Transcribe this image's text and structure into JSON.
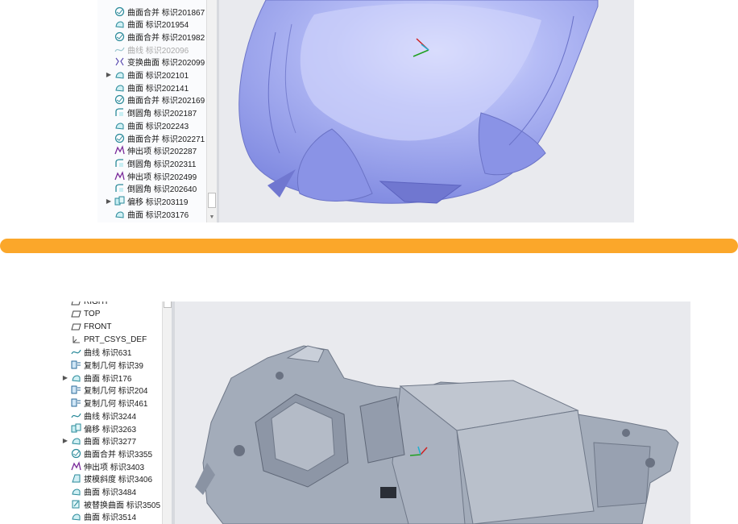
{
  "top_panel": {
    "tree_items": [
      {
        "label": "曲面合并 标识201867",
        "icon": "merge-icon",
        "expand": false,
        "dim": false
      },
      {
        "label": "曲面 标识201954",
        "icon": "surface-icon",
        "expand": false,
        "dim": false
      },
      {
        "label": "曲面合并 标识201982",
        "icon": "merge-icon",
        "expand": false,
        "dim": false
      },
      {
        "label": "曲线 标识202096",
        "icon": "curve-icon",
        "expand": false,
        "dim": true
      },
      {
        "label": "变换曲面 标识202099",
        "icon": "transform-surface-icon",
        "expand": false,
        "dim": false
      },
      {
        "label": "曲面 标识202101",
        "icon": "surface-icon",
        "expand": true,
        "dim": false
      },
      {
        "label": "曲面 标识202141",
        "icon": "surface-icon",
        "expand": false,
        "dim": false
      },
      {
        "label": "曲面合并 标识202169",
        "icon": "merge-icon",
        "expand": false,
        "dim": false
      },
      {
        "label": "倒圆角 标识202187",
        "icon": "round-icon",
        "expand": false,
        "dim": false
      },
      {
        "label": "曲面 标识202243",
        "icon": "surface-icon",
        "expand": false,
        "dim": false
      },
      {
        "label": "曲面合并 标识202271",
        "icon": "merge-icon",
        "expand": false,
        "dim": false
      },
      {
        "label": "伸出项 标识202287",
        "icon": "protrusion-icon",
        "expand": false,
        "dim": false
      },
      {
        "label": "倒圆角 标识202311",
        "icon": "round-icon",
        "expand": false,
        "dim": false
      },
      {
        "label": "伸出项 标识202499",
        "icon": "protrusion-icon",
        "expand": false,
        "dim": false
      },
      {
        "label": "倒圆角 标识202640",
        "icon": "round-icon",
        "expand": false,
        "dim": false
      },
      {
        "label": "偏移 标识203119",
        "icon": "offset-icon",
        "expand": true,
        "dim": false
      },
      {
        "label": "曲面 标识203176",
        "icon": "surface-icon",
        "expand": false,
        "dim": false
      }
    ]
  },
  "bottom_panel": {
    "tree_items": [
      {
        "label": "RIGHT",
        "icon": "datum-plane-icon",
        "expand": false,
        "dim": false
      },
      {
        "label": "TOP",
        "icon": "datum-plane-icon",
        "expand": false,
        "dim": false
      },
      {
        "label": "FRONT",
        "icon": "datum-plane-icon",
        "expand": false,
        "dim": false
      },
      {
        "label": "PRT_CSYS_DEF",
        "icon": "csys-icon",
        "expand": false,
        "dim": false
      },
      {
        "label": "曲线 标识631",
        "icon": "curve-icon",
        "expand": false,
        "dim": false
      },
      {
        "label": "复制几何 标识39",
        "icon": "copy-geometry-icon",
        "expand": false,
        "dim": false
      },
      {
        "label": "曲面 标识176",
        "icon": "surface-icon",
        "expand": true,
        "dim": false
      },
      {
        "label": "复制几何 标识204",
        "icon": "copy-geometry-icon",
        "expand": false,
        "dim": false
      },
      {
        "label": "复制几何 标识461",
        "icon": "copy-geometry-icon",
        "expand": false,
        "dim": false
      },
      {
        "label": "曲线 标识3244",
        "icon": "curve-icon",
        "expand": false,
        "dim": false
      },
      {
        "label": "偏移 标识3263",
        "icon": "offset-icon",
        "expand": false,
        "dim": false
      },
      {
        "label": "曲面 标识3277",
        "icon": "surface-icon",
        "expand": true,
        "dim": false
      },
      {
        "label": "曲面合并 标识3355",
        "icon": "merge-icon",
        "expand": false,
        "dim": false
      },
      {
        "label": "伸出项 标识3403",
        "icon": "protrusion-icon",
        "expand": false,
        "dim": false
      },
      {
        "label": "拔模斜度 标识3406",
        "icon": "draft-icon",
        "expand": false,
        "dim": false
      },
      {
        "label": "曲面 标识3484",
        "icon": "surface-icon",
        "expand": false,
        "dim": false
      },
      {
        "label": "被替换曲面 标识3505",
        "icon": "replaced-surface-icon",
        "expand": false,
        "dim": false
      },
      {
        "label": "曲面 标识3514",
        "icon": "surface-icon",
        "expand": false,
        "dim": false
      }
    ]
  },
  "colors": {
    "divider": "#fba72a",
    "car_body": "#a9b1f2",
    "chassis": "#9ea7b6",
    "viewport": "#e9eaee"
  }
}
